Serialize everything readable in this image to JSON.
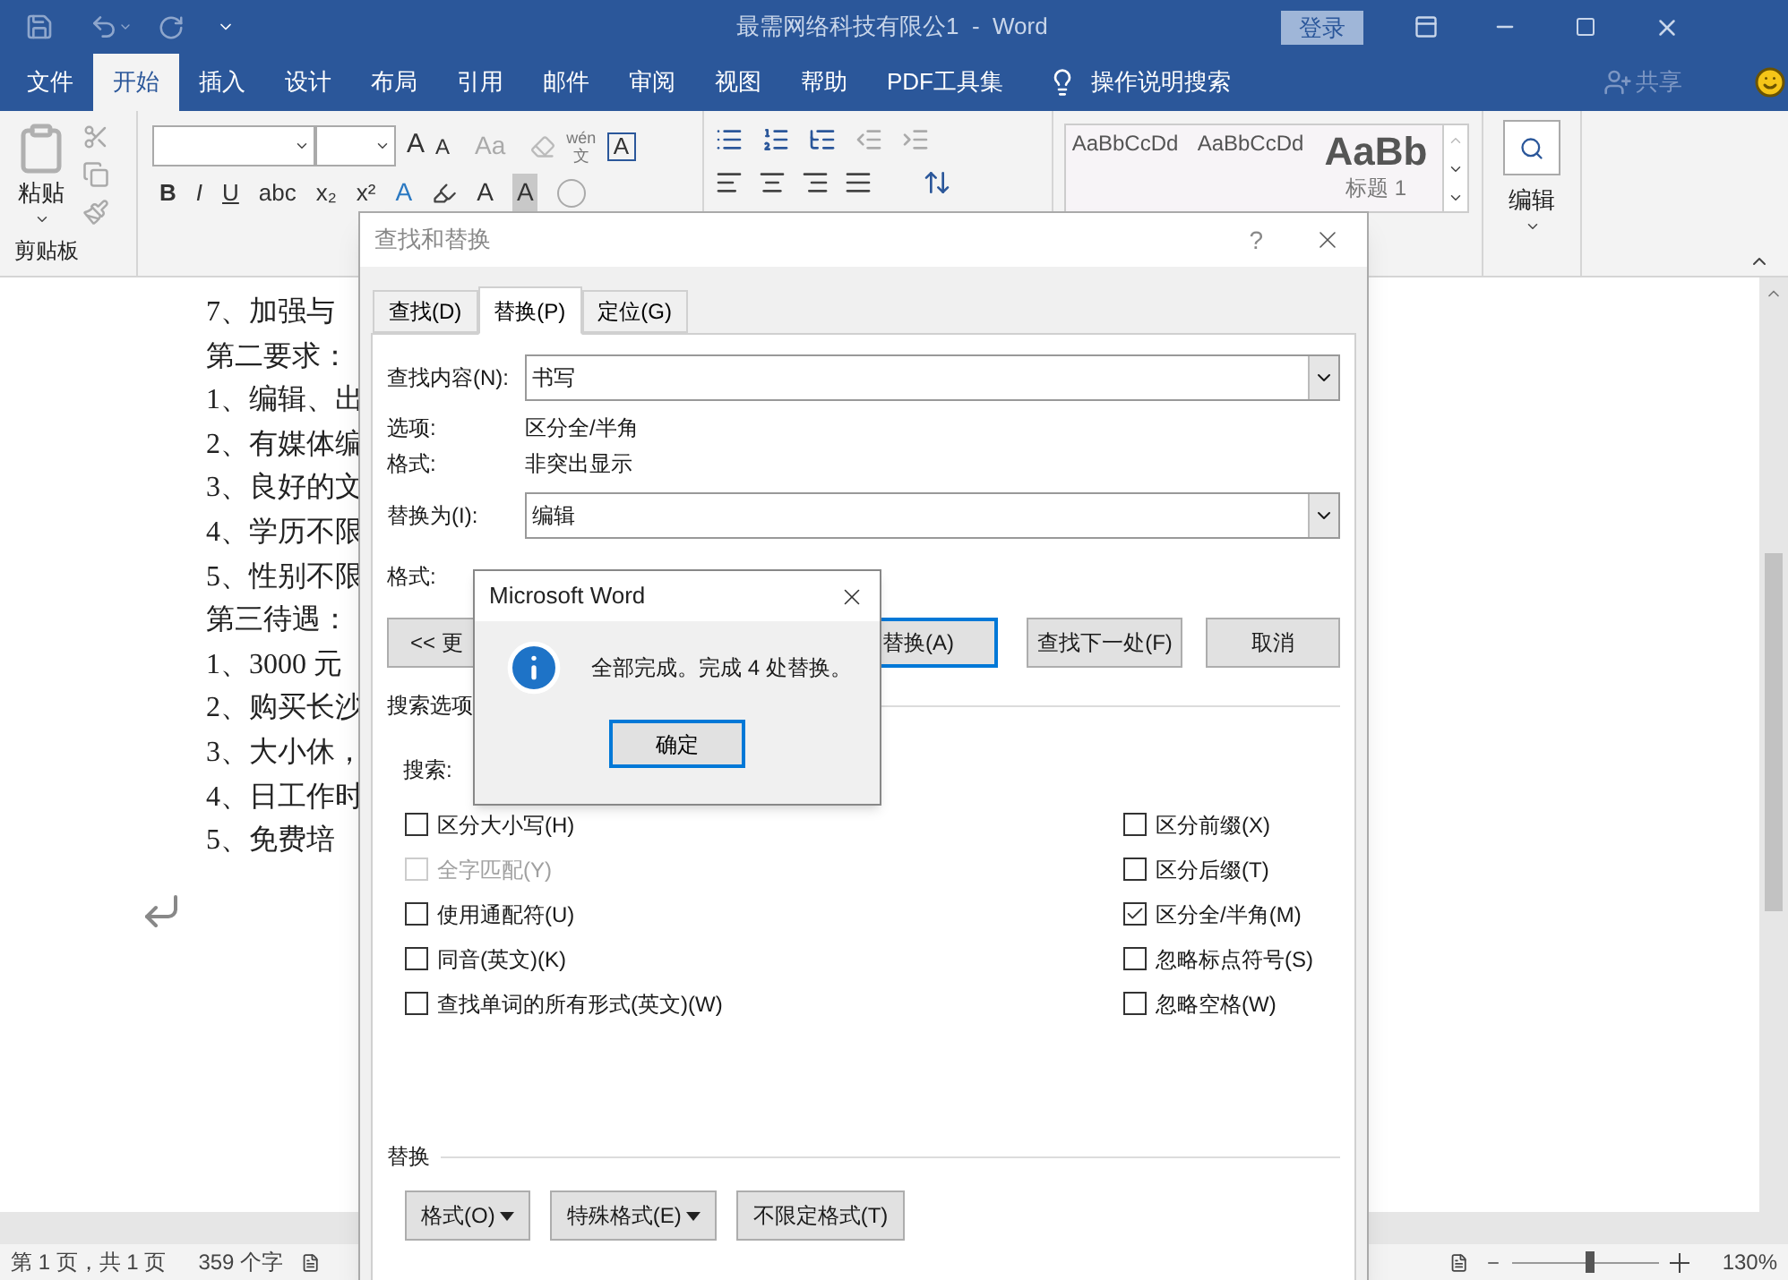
{
  "window": {
    "title": "最需网络科技有限公1  -  Word",
    "login_button": "登录"
  },
  "ribbon_tabs": [
    {
      "label": "文件",
      "selected": false
    },
    {
      "label": "开始",
      "selected": true
    },
    {
      "label": "插入",
      "selected": false
    },
    {
      "label": "设计",
      "selected": false
    },
    {
      "label": "布局",
      "selected": false
    },
    {
      "label": "引用",
      "selected": false
    },
    {
      "label": "邮件",
      "selected": false
    },
    {
      "label": "审阅",
      "selected": false
    },
    {
      "label": "视图",
      "selected": false
    },
    {
      "label": "帮助",
      "selected": false
    },
    {
      "label": "PDF工具集",
      "selected": false
    }
  ],
  "tell_me": "操作说明搜索",
  "share": "共享",
  "ribbon": {
    "paste": "粘贴",
    "clipboard_group": "剪贴板",
    "grow_font": "A",
    "shrink_font": "A",
    "change_case": "Aa",
    "phonetic": "wén",
    "phonetic_char": "文",
    "char_border": "A",
    "font_buttons": [
      "B",
      "I",
      "U",
      "abc",
      "x₂",
      "x²"
    ],
    "text_effects": "A",
    "font_color": "A",
    "char_shading": "A",
    "styles": [
      {
        "sample": "AaBbCcDd",
        "kind": "normal"
      },
      {
        "sample": "AaBbCcDd",
        "kind": "normal"
      },
      {
        "sample": "AaBb",
        "kind": "heading",
        "name": "标题 1"
      }
    ],
    "editing": "编辑"
  },
  "document": {
    "lines": [
      "7、加强与",
      "第二要求：",
      "1、编辑、出",
      "2、有媒体编",
      "3、良好的文",
      "4、学历不限",
      "5、性别不限",
      "第三待遇：",
      "1、3000 元",
      "2、购买长沙",
      "3、大小休，",
      "4、日工作时",
      "5、免费培"
    ]
  },
  "dialog": {
    "title": "查找和替换",
    "help": "?",
    "tabs": [
      {
        "label": "查找(D)",
        "selected": false
      },
      {
        "label": "替换(P)",
        "selected": true
      },
      {
        "label": "定位(G)",
        "selected": false
      }
    ],
    "find_label": "查找内容(N):",
    "find_value": "书写",
    "options_label": "选项:",
    "options_value": "区分全/半角",
    "format_label": "格式:",
    "format_value": "非突出显示",
    "replace_label": "替换为(I):",
    "replace_value": "编辑",
    "replace_format_label": "格式:",
    "buttons": [
      {
        "label": "<< 更",
        "default": false
      },
      {
        "label": "替换(A)",
        "default": true
      },
      {
        "label": "查找下一处(F)",
        "default": false
      },
      {
        "label": "取消",
        "default": false
      }
    ],
    "search_options_heading": "搜索选项",
    "search_label": "搜索:",
    "options_left": [
      {
        "label": "区分大小写(H)",
        "checked": false,
        "disabled": false
      },
      {
        "label": "全字匹配(Y)",
        "checked": false,
        "disabled": true
      },
      {
        "label": "使用通配符(U)",
        "checked": false,
        "disabled": false
      },
      {
        "label": "同音(英文)(K)",
        "checked": false,
        "disabled": false
      },
      {
        "label": "查找单词的所有形式(英文)(W)",
        "checked": false,
        "disabled": false
      }
    ],
    "options_right": [
      {
        "label": "区分前缀(X)",
        "checked": false,
        "disabled": false
      },
      {
        "label": "区分后缀(T)",
        "checked": false,
        "disabled": false
      },
      {
        "label": "区分全/半角(M)",
        "checked": true,
        "disabled": false
      },
      {
        "label": "忽略标点符号(S)",
        "checked": false,
        "disabled": false
      },
      {
        "label": "忽略空格(W)",
        "checked": false,
        "disabled": false
      }
    ],
    "replace_heading": "替换",
    "bottom_buttons": [
      {
        "label": "格式(O)",
        "dropdown": true
      },
      {
        "label": "特殊格式(E)",
        "dropdown": true
      },
      {
        "label": "不限定格式(T)",
        "dropdown": false
      }
    ]
  },
  "message_box": {
    "title": "Microsoft Word",
    "message": "全部完成。完成 4 处替换。",
    "ok": "确定"
  },
  "status_bar": {
    "page": "第 1 页，共 1 页",
    "words": "359 个字",
    "zoom": "130%",
    "zoom_slider": {
      "level": 0.52
    }
  }
}
